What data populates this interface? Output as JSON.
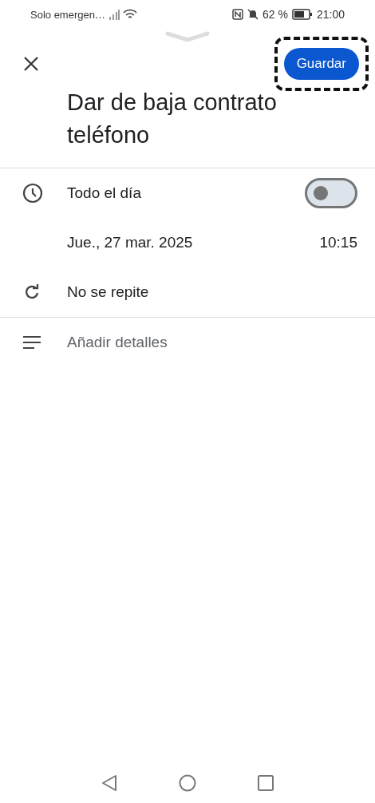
{
  "status_bar": {
    "carrier": "Solo emergen…",
    "battery": "62 %",
    "time": "21:00"
  },
  "header": {
    "save_button": {
      "label": "Guardar",
      "focused": true
    }
  },
  "title": "Dar de baja contrato teléfono",
  "all_day": {
    "label": "Todo el día",
    "on": false
  },
  "date": {
    "date": "Jue., 27 mar. 2025",
    "time": "10:15"
  },
  "repeat": {
    "label": "No se repite"
  },
  "details": {
    "placeholder": "Añadir detalles"
  }
}
